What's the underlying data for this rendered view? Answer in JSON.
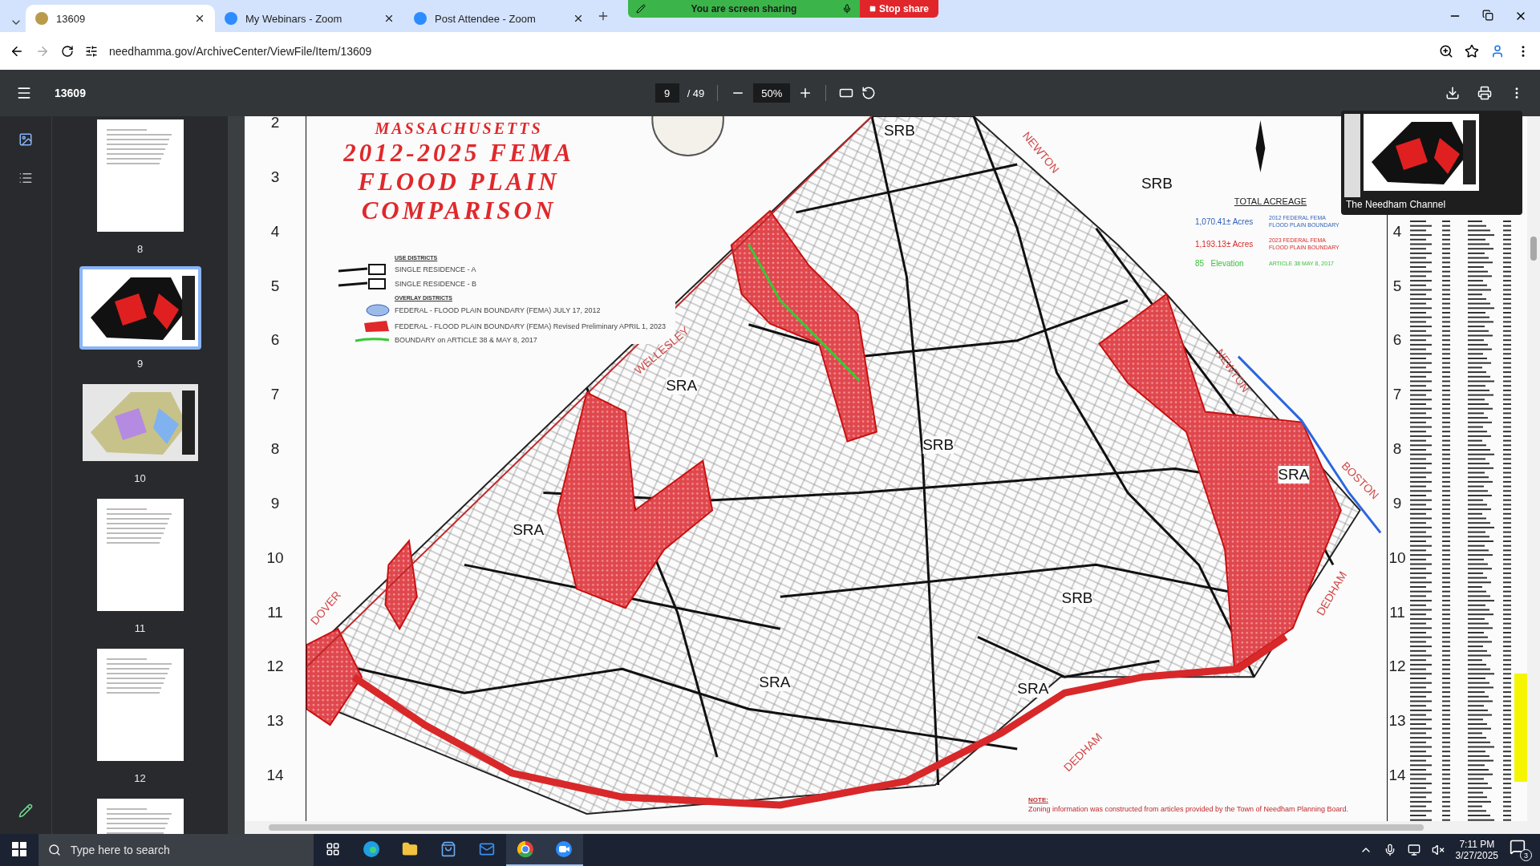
{
  "browser": {
    "tabs": [
      {
        "title": "13609",
        "kind": "town",
        "selected": true
      },
      {
        "title": "My Webinars - Zoom",
        "kind": "meeting",
        "selected": false
      },
      {
        "title": "Post Attendee - Zoom",
        "kind": "meeting",
        "selected": false
      }
    ],
    "address": "needhamma.gov/ArchiveCenter/ViewFile/Item/13609"
  },
  "share_banner": {
    "text": "You are screen sharing",
    "button": "Stop share"
  },
  "pdf_toolbar": {
    "title": "13609",
    "page": "9",
    "total": "/ 49",
    "zoom": "50%"
  },
  "thumbnails": [
    {
      "label": "8",
      "kind": "text",
      "selected": false
    },
    {
      "label": "9",
      "kind": "map",
      "selected": true
    },
    {
      "label": "10",
      "kind": "color-map",
      "selected": false
    },
    {
      "label": "11",
      "kind": "text",
      "selected": false
    },
    {
      "label": "12",
      "kind": "text",
      "selected": false
    },
    {
      "kind": "text",
      "selected": false
    }
  ],
  "map": {
    "subtitle": "MASSACHUSETTS",
    "title": [
      "2012-2025 FEMA",
      "FLOOD PLAIN",
      "COMPARISON"
    ],
    "legend": {
      "use_heading": "USE DISTRICTS",
      "use_items": [
        "SINGLE RESIDENCE - A",
        "SINGLE RESIDENCE - B"
      ],
      "overlay_heading": "OVERLAY DISTRICTS",
      "overlay_items": [
        {
          "kind": "blue",
          "text": "FEDERAL - FLOOD PLAIN BOUNDARY (FEMA) JULY 17, 2012"
        },
        {
          "kind": "red",
          "text": "FEDERAL - FLOOD PLAIN BOUNDARY (FEMA) Revised Preliminary APRIL 1, 2023"
        },
        {
          "kind": "green",
          "text": "BOUNDARY on ARTICLE 38 & MAY 8, 2017"
        }
      ]
    },
    "acreage": {
      "heading": "TOTAL ACREAGE",
      "rows": [
        {
          "value": "1,070.41± Acres",
          "label": "2012 FEDERAL FEMA FLOOD PLAIN BOUNDARY",
          "color": "#2f5fb8"
        },
        {
          "value": "1,193.13± Acres",
          "label": "2023 FEDERAL FEMA FLOOD PLAIN BOUNDARY",
          "color": "#d8282a"
        },
        {
          "value": "85   Elevation",
          "label": "ARTICLE 38 MAY 8, 2017",
          "color": "#3cc23c"
        }
      ]
    },
    "labels": [
      "SRB",
      "SRB",
      "SRA",
      "SRA",
      "SRB",
      "SRA",
      "SRB",
      "SRA",
      "SRA",
      "WELLESLEY",
      "NEWTON",
      "NEWTON",
      "BOSTON",
      "DEDHAM",
      "DEDHAM",
      "DOVER"
    ],
    "note_heading": "NOTE:",
    "note": "Zoning information was constructed from articles provided by the Town of Needham Planning Board.",
    "left_ruler": [
      "2",
      "3",
      "4",
      "5",
      "6",
      "7",
      "8",
      "9",
      "10",
      "11",
      "12",
      "13",
      "14"
    ],
    "right_ruler": [
      "4",
      "5",
      "6",
      "7",
      "8",
      "9",
      "10",
      "11",
      "12",
      "13",
      "14"
    ]
  },
  "video_overlay": {
    "caption": "The Needham Channel"
  },
  "taskbar": {
    "search_placeholder": "Type here to search",
    "time": "7:11 PM",
    "date": "3/27/2025",
    "notifications": "3"
  }
}
